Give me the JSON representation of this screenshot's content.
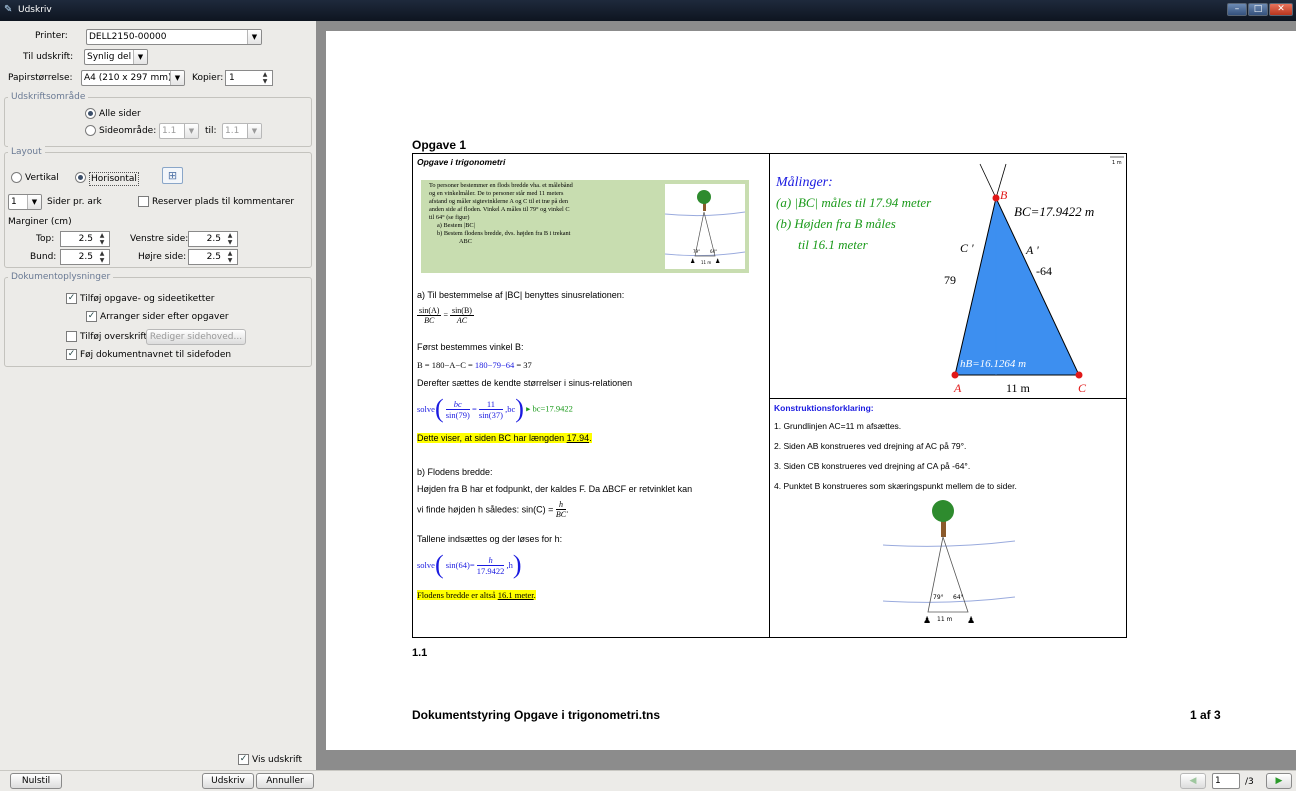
{
  "window": {
    "title": "Udskriv"
  },
  "settings": {
    "printer_label": "Printer:",
    "printer_value": "DELL2150-00000",
    "print_what_label": "Til udskrift:",
    "print_what_value": "Synlig del",
    "paper_label": "Papirstørrelse:",
    "paper_value": "A4 (210 x 297 mm)",
    "copies_label": "Kopier:",
    "copies_value": "1"
  },
  "print_range": {
    "title": "Udskriftsområde",
    "all_pages": "Alle sider",
    "page_range": "Sideområde:",
    "from": "1.1",
    "to_label": "til:",
    "to": "1.1"
  },
  "layout": {
    "title": "Layout",
    "vertical": "Vertikal",
    "horizontal": "Horisontal",
    "pages_per_sheet_value": "1",
    "pages_per_sheet_label": "Sider pr. ark",
    "reserve_comments": "Reserver plads til kommentarer",
    "margins_label": "Marginer (cm)",
    "top_label": "Top:",
    "top_value": "2.5",
    "left_label": "Venstre side:",
    "left_value": "2.5",
    "bottom_label": "Bund:",
    "bottom_value": "2.5",
    "right_label": "Højre side:",
    "right_value": "2.5"
  },
  "doc_info": {
    "title": "Dokumentoplysninger",
    "add_labels": "Tilføj opgave- og sideetiketter",
    "arrange": "Arranger sider efter opgaver",
    "add_header": "Tilføj overskrift",
    "edit_header": "Rediger sidehoved...",
    "add_footer_name": "Føj dokumentnavnet til sidefoden"
  },
  "show_print": "Vis udskrift",
  "buttons": {
    "reset": "Nulstil",
    "print": "Udskriv",
    "cancel": "Annuller"
  },
  "pager": {
    "current": "1",
    "total": "/3"
  },
  "page": {
    "heading": "Opgave 1",
    "left": {
      "title": "Opgave i trigonometri",
      "problem": [
        "To personer bestemmer en flods bredde vha. et målebånd",
        "og en vinkelmåler. De to personer står med 11 meters",
        "afstand og måler sigtevinklerne A og C til et træ på den",
        "anden side af floden. Vinkel A måles til 79° og vinkel C",
        "til 64° (se figur)"
      ],
      "problem_a": "a)   Bestem |BC|",
      "problem_b": [
        "b)   Bestem flodens bredde, dvs. højden fra B i trekant",
        "ABC"
      ],
      "fig_label": "11 m",
      "fig_angles": [
        "79°",
        "64°"
      ],
      "a_intro": "a) Til bestemmelse af |BC| benyttes sinusrelationen:",
      "sinA": "sin(A)",
      "sinB": "sin(B)",
      "BC": "BC",
      "AC": "AC",
      "eq": "=",
      "angle_intro": "Først bestemmes vinkel B:",
      "angle_eq": "B = 180−A−C = ",
      "angle_eq_blue": "180−79−64",
      "angle_eq_result": " = 37",
      "insert_intro": "Derefter sættes de kendte størrelser i sinus-relationen",
      "solve": "solve",
      "bc": "bc",
      "sin79": "sin(79)",
      "eleven": "11",
      "sin37": "sin(37)",
      "bcvar": ",bc",
      "solve_result": "▸ bc=17.9422",
      "result_a": "Dette viser, at siden BC har længden ",
      "result_a_val": "17.94",
      "result_a_end": ".",
      "b_intro": "b) Flodens bredde:",
      "b_text1": "Højden fra B har et fodpunkt, der kaldes F. Da ∆BCF er retvinklet kan",
      "b_text2a": "vi finde højden h således: sin(C) = ",
      "h": "h",
      "b_text2b": ".",
      "b_text3": "Tallene indsættes og der løses for h:",
      "sin64": "sin(64)=",
      "h17": "17.9422",
      "hvar": ",h",
      "result_b": "Flodens bredde er altså ",
      "result_b_val": "16.1 meter",
      "result_b_end": "."
    },
    "graph": {
      "corner_label": "1 m",
      "measure_title": "Målinger:",
      "measure_a": "(a) |BC| måles til 17.94 meter",
      "measure_b1": "(b) Højden fra B måles",
      "measure_b2": "til 16.1 meter",
      "bc_label": "BC=17.9422 m",
      "B": "B",
      "A": "A",
      "C": "C",
      "Cp": "C '",
      "Ap": "A '",
      "side79": "79",
      "side64": "-64",
      "hb": "hB=16.1264 m",
      "base": "11 m"
    },
    "construction": {
      "title": "Konstruktionsforklaring:",
      "steps": [
        "1. Grundlinjen AC=11 m afsættes.",
        "2. Siden AB konstrueres ved drejning af AC på 79°.",
        "3. Siden CB konstrueres ved drejning af CA på -64°.",
        "4. Punktet B konstrueres som skæringspunkt mellem de to sider."
      ]
    },
    "page_number": "1.1",
    "footer_doc": "Dokumentstyring Opgave i trigonometri.tns",
    "footer_page": "1 af 3"
  },
  "colors": {
    "triangle_fill": "#3d8ff0",
    "point": "#e01818",
    "measure_green": "#1a9a1a",
    "measure_blue": "#1a1ae0",
    "highlight": "#ffff00",
    "problem_bg": "#c8ddb0"
  }
}
